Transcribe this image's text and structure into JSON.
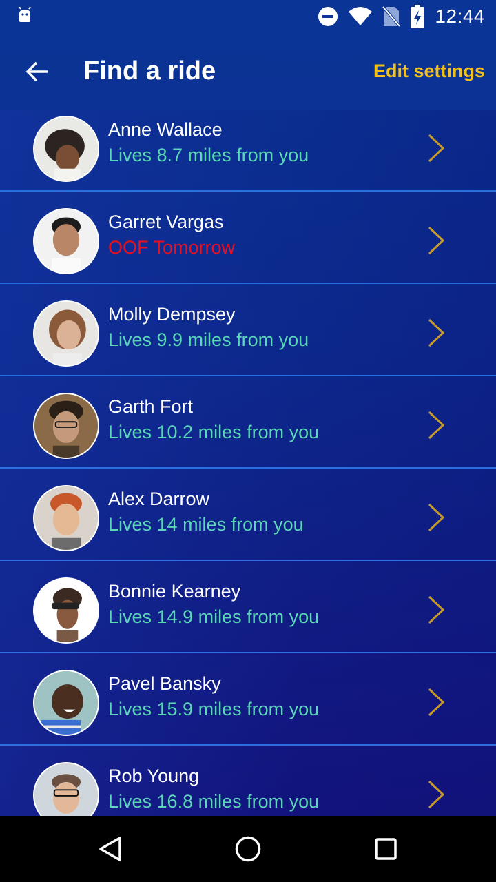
{
  "status_bar": {
    "time": "12:44",
    "icons": [
      "android-icon",
      "do-not-disturb-icon",
      "wifi-icon",
      "no-sim-icon",
      "battery-charging-icon"
    ]
  },
  "app_bar": {
    "back_icon": "arrow-left-icon",
    "title": "Find a ride",
    "edit_settings_label": "Edit settings"
  },
  "colors": {
    "title": "#ffffff",
    "accent": "#f2c21b",
    "distance_text": "#5bd6b7",
    "alert_text": "#e8101e",
    "divider": "#2a6ee0"
  },
  "rides": [
    {
      "name": "Anne Wallace",
      "detail": "Lives 8.7 miles from you",
      "alert": false
    },
    {
      "name": "Garret Vargas",
      "detail": "OOF Tomorrow",
      "alert": true
    },
    {
      "name": "Molly Dempsey",
      "detail": "Lives 9.9 miles from you",
      "alert": false
    },
    {
      "name": "Garth Fort",
      "detail": "Lives 10.2 miles from you",
      "alert": false
    },
    {
      "name": "Alex Darrow",
      "detail": "Lives 14 miles from you",
      "alert": false
    },
    {
      "name": "Bonnie Kearney",
      "detail": "Lives 14.9 miles from you",
      "alert": false
    },
    {
      "name": "Pavel Bansky",
      "detail": "Lives 15.9 miles from you",
      "alert": false
    },
    {
      "name": "Rob Young",
      "detail": "Lives 16.8 miles from you",
      "alert": false
    }
  ],
  "nav_bar": {
    "icons": [
      "back-triangle-icon",
      "home-circle-icon",
      "recents-square-icon"
    ]
  }
}
